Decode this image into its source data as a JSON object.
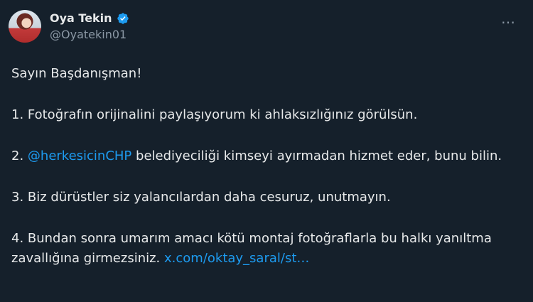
{
  "author": {
    "display_name": "Oya Tekin",
    "handle": "@Oyatekin01",
    "verified": true,
    "verified_color": "#1d9bf0"
  },
  "menu": {
    "more_icon": "…"
  },
  "tweet": {
    "greeting": "Sayın Başdanışman!",
    "p1": "1. Fotoğrafın orijinalini paylaşıyorum ki ahlaksızlığınız görülsün.",
    "p2_prefix": "2. ",
    "p2_mention": "@herkesicinCHP",
    "p2_rest": " belediyeciliği kimseyi ayırmadan hizmet eder, bunu bilin.",
    "p3": "3. Biz dürüstler siz yalancılardan daha cesuruz, unutmayın.",
    "p4_text": "4. Bundan sonra umarım amacı kötü montaj fotoğraflarla bu halkı yanıltma zavallığına girmezsiniz. ",
    "p4_link": "x.com/oktay_saral/st…"
  },
  "colors": {
    "background": "#15202b",
    "text": "#e7e9ea",
    "secondary": "#8b98a5",
    "link": "#1d9bf0"
  }
}
